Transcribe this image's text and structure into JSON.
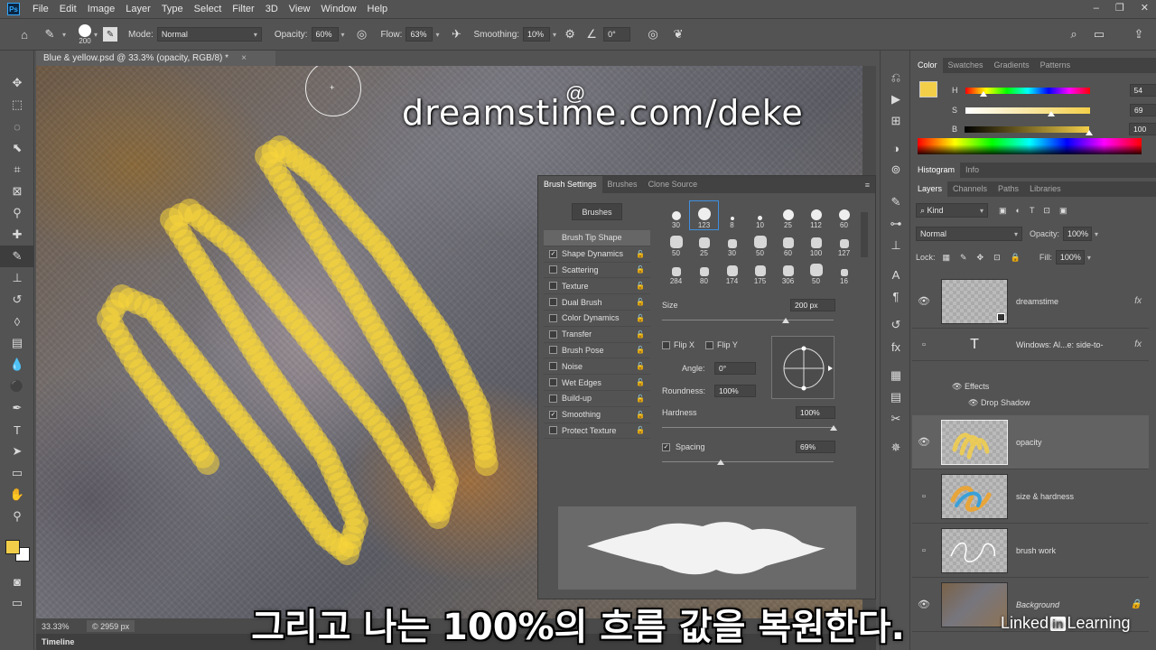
{
  "app": {
    "logo": "Ps"
  },
  "menu": [
    "File",
    "Edit",
    "Image",
    "Layer",
    "Type",
    "Select",
    "Filter",
    "3D",
    "View",
    "Window",
    "Help"
  ],
  "window_controls": [
    "–",
    "❐",
    "✕"
  ],
  "options": {
    "brush_size": "200",
    "mode_label": "Mode:",
    "mode_value": "Normal",
    "opacity_label": "Opacity:",
    "opacity_value": "60%",
    "flow_label": "Flow:",
    "flow_value": "63%",
    "smoothing_label": "Smoothing:",
    "smoothing_value": "10%",
    "angle_value": "0°"
  },
  "document": {
    "tab_title": "Blue & yellow.psd @ 33.3% (opacity, RGB/8) *",
    "close": "×"
  },
  "watermark": "dreamstime.com/deke",
  "status": {
    "zoom": "33.33%",
    "doc_info": "© 2959 px"
  },
  "timeline_label": "Timeline",
  "brush_settings": {
    "tabs": [
      "Brush Settings",
      "Brushes",
      "Clone Source"
    ],
    "brushes_button": "Brushes",
    "list": [
      {
        "label": "Brush Tip Shape",
        "checkbox": false,
        "checked": false,
        "lock": false,
        "selected": true
      },
      {
        "label": "Shape Dynamics",
        "checkbox": true,
        "checked": true,
        "lock": true
      },
      {
        "label": "Scattering",
        "checkbox": true,
        "checked": false,
        "lock": true
      },
      {
        "label": "Texture",
        "checkbox": true,
        "checked": false,
        "lock": true
      },
      {
        "label": "Dual Brush",
        "checkbox": true,
        "checked": false,
        "lock": true
      },
      {
        "label": "Color Dynamics",
        "checkbox": true,
        "checked": false,
        "lock": true
      },
      {
        "label": "Transfer",
        "checkbox": true,
        "checked": false,
        "lock": true
      },
      {
        "label": "Brush Pose",
        "checkbox": true,
        "checked": false,
        "lock": true
      },
      {
        "label": "Noise",
        "checkbox": true,
        "checked": false,
        "lock": true
      },
      {
        "label": "Wet Edges",
        "checkbox": true,
        "checked": false,
        "lock": true
      },
      {
        "label": "Build-up",
        "checkbox": true,
        "checked": false,
        "lock": true
      },
      {
        "label": "Smoothing",
        "checkbox": true,
        "checked": true,
        "lock": true
      },
      {
        "label": "Protect Texture",
        "checkbox": true,
        "checked": false,
        "lock": true
      }
    ],
    "presets": [
      "30",
      "123",
      "8",
      "10",
      "25",
      "112",
      "60",
      "50",
      "25",
      "30",
      "50",
      "60",
      "100",
      "127",
      "284",
      "80",
      "174",
      "175",
      "306",
      "50",
      "16"
    ],
    "selected_preset": "123",
    "size_label": "Size",
    "size_value": "200 px",
    "size_level": 0.72,
    "flipx": "Flip X",
    "flipy": "Flip Y",
    "angle_label": "Angle:",
    "angle_value": "0°",
    "roundness_label": "Roundness:",
    "roundness_value": "100%",
    "hardness_label": "Hardness",
    "hardness_value": "100%",
    "hardness_level": 1.0,
    "spacing_label": "Spacing",
    "spacing_value": "69%",
    "spacing_level": 0.34
  },
  "color_panel": {
    "tabs": [
      "Color",
      "Swatches",
      "Gradients",
      "Patterns"
    ],
    "swatch": "#f3cf49",
    "H": {
      "label": "H",
      "value": "54",
      "level": 0.15
    },
    "S": {
      "label": "S",
      "value": "69",
      "level": 0.69
    },
    "B": {
      "label": "B",
      "value": "100",
      "level": 1.0
    }
  },
  "histogram_tabs": [
    "Histogram",
    "Info"
  ],
  "layers_panel": {
    "tabs": [
      "Layers",
      "Channels",
      "Paths",
      "Libraries"
    ],
    "kind": "Kind",
    "blend": "Normal",
    "opacity_label": "Opacity:",
    "opacity_value": "100%",
    "lock_label": "Lock:",
    "fill_label": "Fill:",
    "fill_value": "100%",
    "layers": [
      {
        "name": "dreamstime",
        "visible": true,
        "fx": "fx"
      },
      {
        "name": "Windows: Al...e: side-to-",
        "visible": false,
        "fx": "fx",
        "type": "T"
      },
      {
        "name": "opacity",
        "visible": true,
        "selected": true
      },
      {
        "name": "size & hardness",
        "visible": false
      },
      {
        "name": "brush work",
        "visible": false
      },
      {
        "name": "Background",
        "visible": true,
        "locked": true
      }
    ],
    "effects_label": "Effects",
    "drop_shadow_label": "Drop Shadow"
  },
  "caption": "그리고 나는 100%의 흐름 값을 복원한다.",
  "linkedin": {
    "pre": "Linked",
    "in": "in",
    "post": " Learning"
  }
}
